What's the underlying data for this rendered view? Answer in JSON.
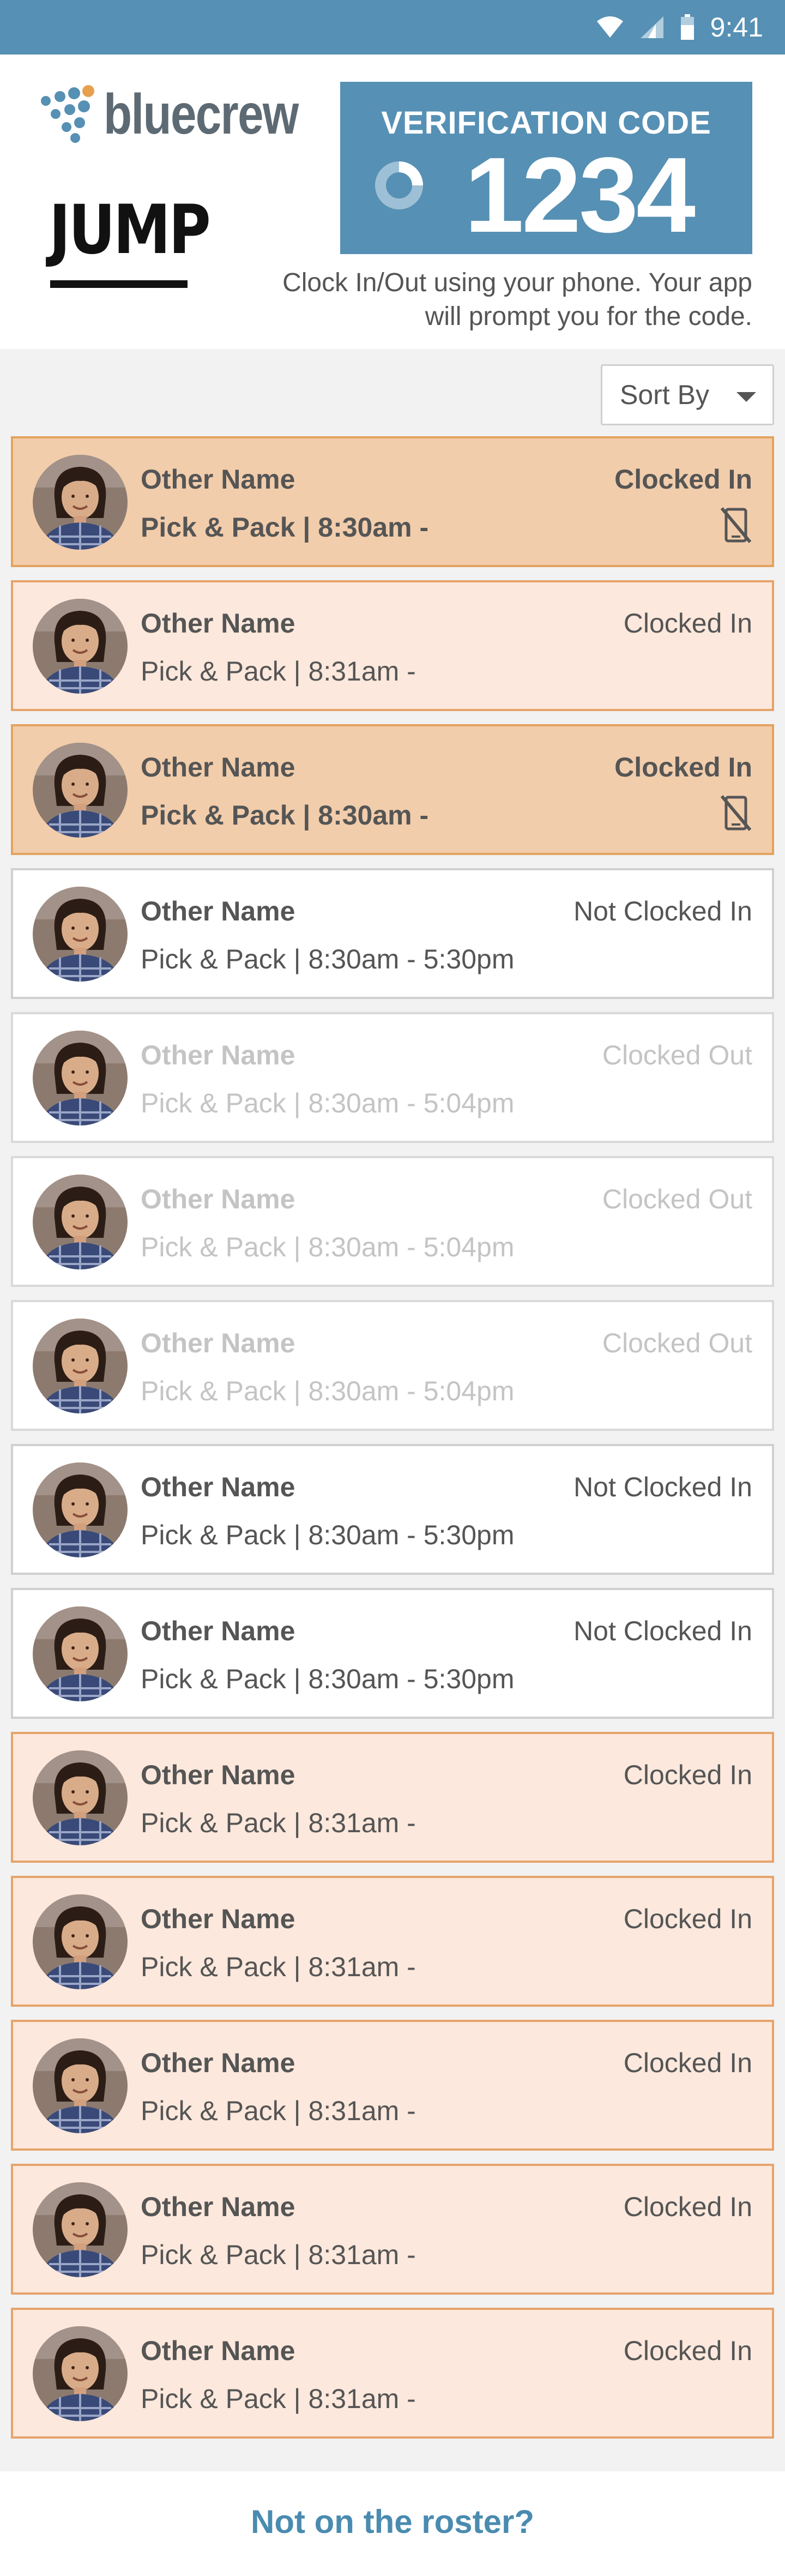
{
  "status_bar": {
    "time": "9:41",
    "icons": [
      "wifi-icon",
      "signal-icon",
      "battery-icon"
    ]
  },
  "header": {
    "brand": "bluecrew",
    "client_logo": "JUMP",
    "verification": {
      "label": "VERIFICATION CODE",
      "code": "1234",
      "icon": "timer-icon"
    },
    "instructions": "Clock In/Out using your phone. Your app will prompt you for the code."
  },
  "sort": {
    "label": "Sort By"
  },
  "colors": {
    "brand_blue": "#5690b4",
    "active_bg": "#f2cdab",
    "clocked_in_bg": "#fce8dc",
    "border_orange": "#e3a35f"
  },
  "roster": [
    {
      "name": "Other Name",
      "shift": "Pick & Pack | 8:30am -",
      "status": "Clocked In",
      "state": "active",
      "icon": "no-phone-icon"
    },
    {
      "name": "Other Name",
      "shift": "Pick & Pack | 8:31am -",
      "status": "Clocked In",
      "state": "clocked-in"
    },
    {
      "name": "Other Name",
      "shift": "Pick & Pack | 8:30am -",
      "status": "Clocked In",
      "state": "active",
      "icon": "no-phone-icon"
    },
    {
      "name": "Other Name",
      "shift": "Pick & Pack | 8:30am - 5:30pm",
      "status": "Not Clocked In",
      "state": "not-in"
    },
    {
      "name": "Other Name",
      "shift": "Pick & Pack | 8:30am - 5:04pm",
      "status": "Clocked Out",
      "state": "out"
    },
    {
      "name": "Other Name",
      "shift": "Pick & Pack | 8:30am - 5:04pm",
      "status": "Clocked Out",
      "state": "out"
    },
    {
      "name": "Other Name",
      "shift": "Pick & Pack | 8:30am - 5:04pm",
      "status": "Clocked Out",
      "state": "out"
    },
    {
      "name": "Other Name",
      "shift": "Pick & Pack | 8:30am - 5:30pm",
      "status": "Not Clocked In",
      "state": "not-in"
    },
    {
      "name": "Other Name",
      "shift": "Pick & Pack | 8:30am - 5:30pm",
      "status": "Not Clocked In",
      "state": "not-in"
    },
    {
      "name": "Other Name",
      "shift": "Pick & Pack | 8:31am -",
      "status": "Clocked In",
      "state": "clocked-in"
    },
    {
      "name": "Other Name",
      "shift": "Pick & Pack | 8:31am -",
      "status": "Clocked In",
      "state": "clocked-in"
    },
    {
      "name": "Other Name",
      "shift": "Pick & Pack | 8:31am -",
      "status": "Clocked In",
      "state": "clocked-in"
    },
    {
      "name": "Other Name",
      "shift": "Pick & Pack | 8:31am -",
      "status": "Clocked In",
      "state": "clocked-in"
    },
    {
      "name": "Other Name",
      "shift": "Pick & Pack | 8:31am -",
      "status": "Clocked In",
      "state": "clocked-in"
    }
  ],
  "footer": {
    "link": "Not on the roster?"
  }
}
